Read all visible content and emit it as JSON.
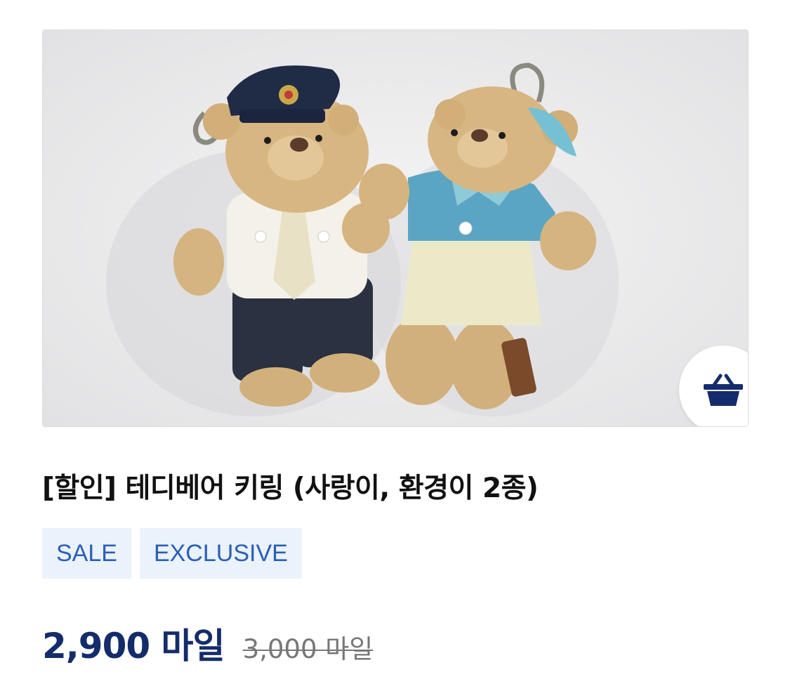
{
  "product": {
    "image_alt": "테디베어 키링 사진",
    "title": "[할인] 테디베어 키링 (사랑이, 환경이 2종)",
    "tags": [
      "SALE",
      "EXCLUSIVE"
    ],
    "price": "2,900 마일",
    "original_price": "3,000 마일"
  },
  "cart_button": {
    "icon": "basket-icon"
  },
  "colors": {
    "navy": "#142c6b",
    "tag_background": "#eaf2fc",
    "tag_text": "#2b5fb4"
  }
}
